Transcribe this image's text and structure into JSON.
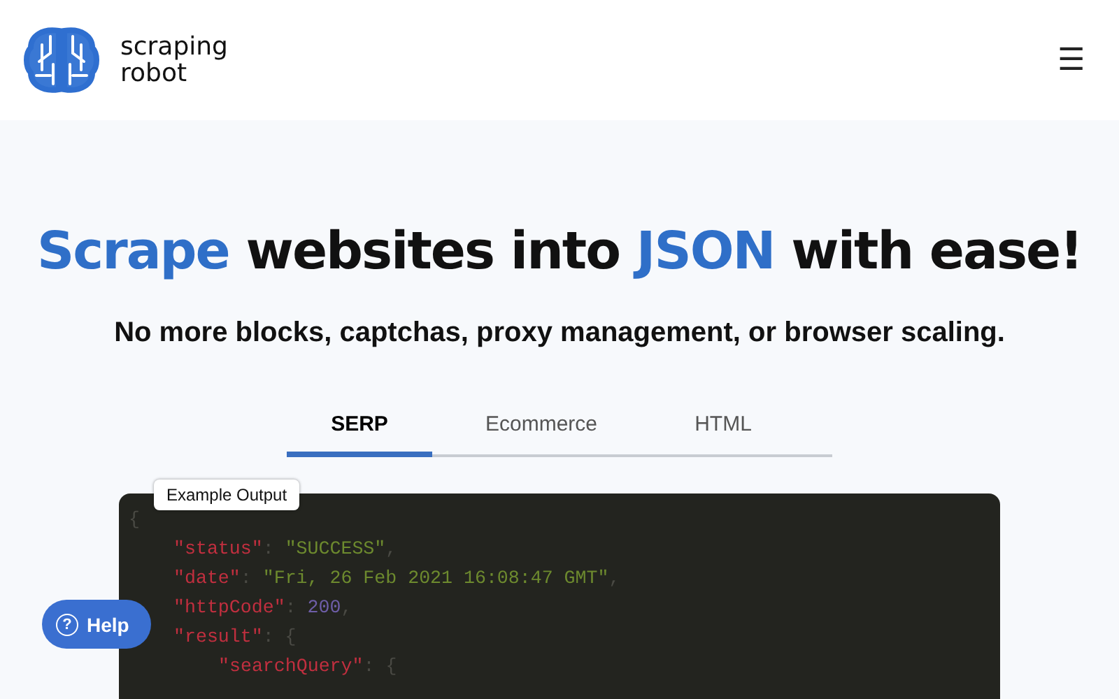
{
  "header": {
    "logo_text": [
      "scraping",
      "robot"
    ],
    "menu_icon": "☰"
  },
  "headline": [
    {
      "text": "Scrape",
      "kind": "accent"
    },
    {
      "text": " websites into ",
      "kind": "plain"
    },
    {
      "text": "JSON",
      "kind": "accent"
    },
    {
      "text": " with ease!",
      "kind": "plain"
    }
  ],
  "subtitle": "No more blocks, captchas, proxy management, or browser scaling.",
  "tabs": [
    {
      "label": "SERP",
      "selected": true
    },
    {
      "label": "Ecommerce",
      "selected": false
    },
    {
      "label": "HTML",
      "selected": false
    }
  ],
  "code": {
    "tooltip": "Example Output",
    "lines": [
      {
        "kind": "top",
        "tokens": [
          {
            "text": "{",
            "kind": "punct"
          }
        ]
      },
      {
        "kind": "member",
        "tokens": [
          {
            "text": "\"status\"",
            "kind": "key"
          },
          {
            "text": ": ",
            "kind": "punct"
          },
          {
            "text": "\"SUCCESS\"",
            "kind": "string"
          },
          {
            "text": ",",
            "kind": "punct"
          }
        ]
      },
      {
        "kind": "member",
        "tokens": [
          {
            "text": "\"date\"",
            "kind": "key"
          },
          {
            "text": ": ",
            "kind": "punct"
          },
          {
            "text": "\"Fri, 26 Feb 2021 16:08:47 GMT\"",
            "kind": "string"
          },
          {
            "text": ",",
            "kind": "punct"
          }
        ]
      },
      {
        "kind": "member",
        "tokens": [
          {
            "text": "\"httpCode\"",
            "kind": "key"
          },
          {
            "text": ": ",
            "kind": "punct"
          },
          {
            "text": "200",
            "kind": "number"
          },
          {
            "text": ",",
            "kind": "punct"
          }
        ]
      },
      {
        "kind": "member",
        "tokens": [
          {
            "text": "\"result\"",
            "kind": "key"
          },
          {
            "text": ": {",
            "kind": "punct"
          }
        ]
      },
      {
        "kind": "inner",
        "tokens": [
          {
            "text": "\"searchQuery\"",
            "kind": "key"
          },
          {
            "text": ": {",
            "kind": "punct"
          }
        ]
      }
    ]
  },
  "help_button": {
    "label": "Help",
    "icon": "?"
  }
}
